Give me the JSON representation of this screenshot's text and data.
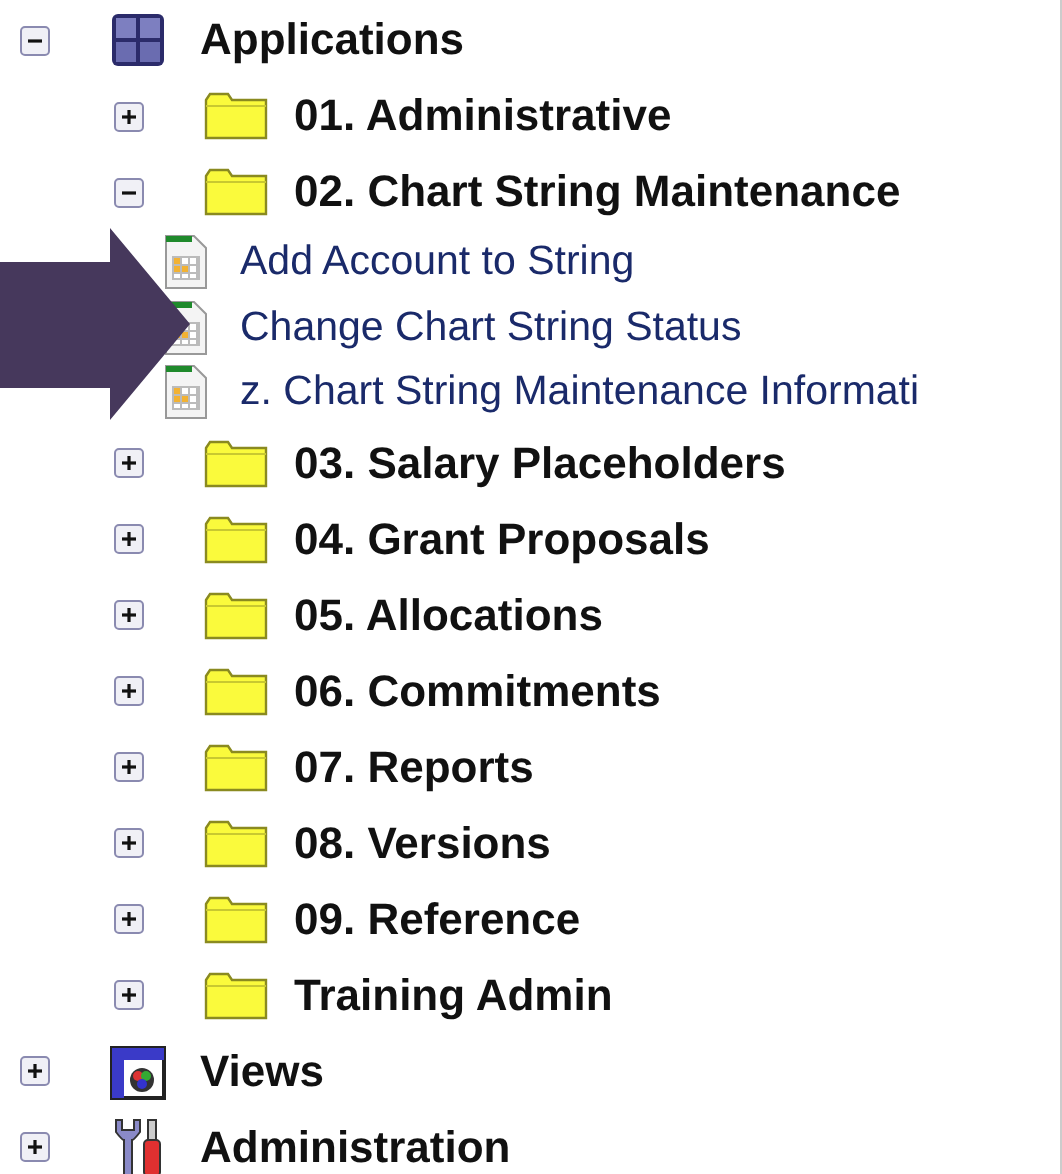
{
  "tree": [
    {
      "label": "Applications",
      "kind": "grid",
      "expanded": true,
      "children": [
        {
          "label": "01. Administrative",
          "kind": "folder",
          "expanded": false
        },
        {
          "label": "02. Chart String Maintenance",
          "kind": "folder",
          "expanded": true,
          "children": [
            {
              "label": "Add Account to String",
              "kind": "page"
            },
            {
              "label": "Change Chart String Status",
              "kind": "page"
            },
            {
              "label": "z. Chart String Maintenance Informati",
              "kind": "page"
            }
          ]
        },
        {
          "label": "03. Salary Placeholders",
          "kind": "folder",
          "expanded": false
        },
        {
          "label": "04. Grant Proposals",
          "kind": "folder",
          "expanded": false
        },
        {
          "label": "05. Allocations",
          "kind": "folder",
          "expanded": false
        },
        {
          "label": "06. Commitments",
          "kind": "folder",
          "expanded": false
        },
        {
          "label": "07. Reports",
          "kind": "folder",
          "expanded": false
        },
        {
          "label": "08. Versions",
          "kind": "folder",
          "expanded": false
        },
        {
          "label": "09. Reference",
          "kind": "folder",
          "expanded": false
        },
        {
          "label": "Training Admin",
          "kind": "folder",
          "expanded": false
        }
      ]
    },
    {
      "label": "Views",
      "kind": "window",
      "expanded": false
    },
    {
      "label": "Administration",
      "kind": "tools",
      "expanded": false
    }
  ]
}
